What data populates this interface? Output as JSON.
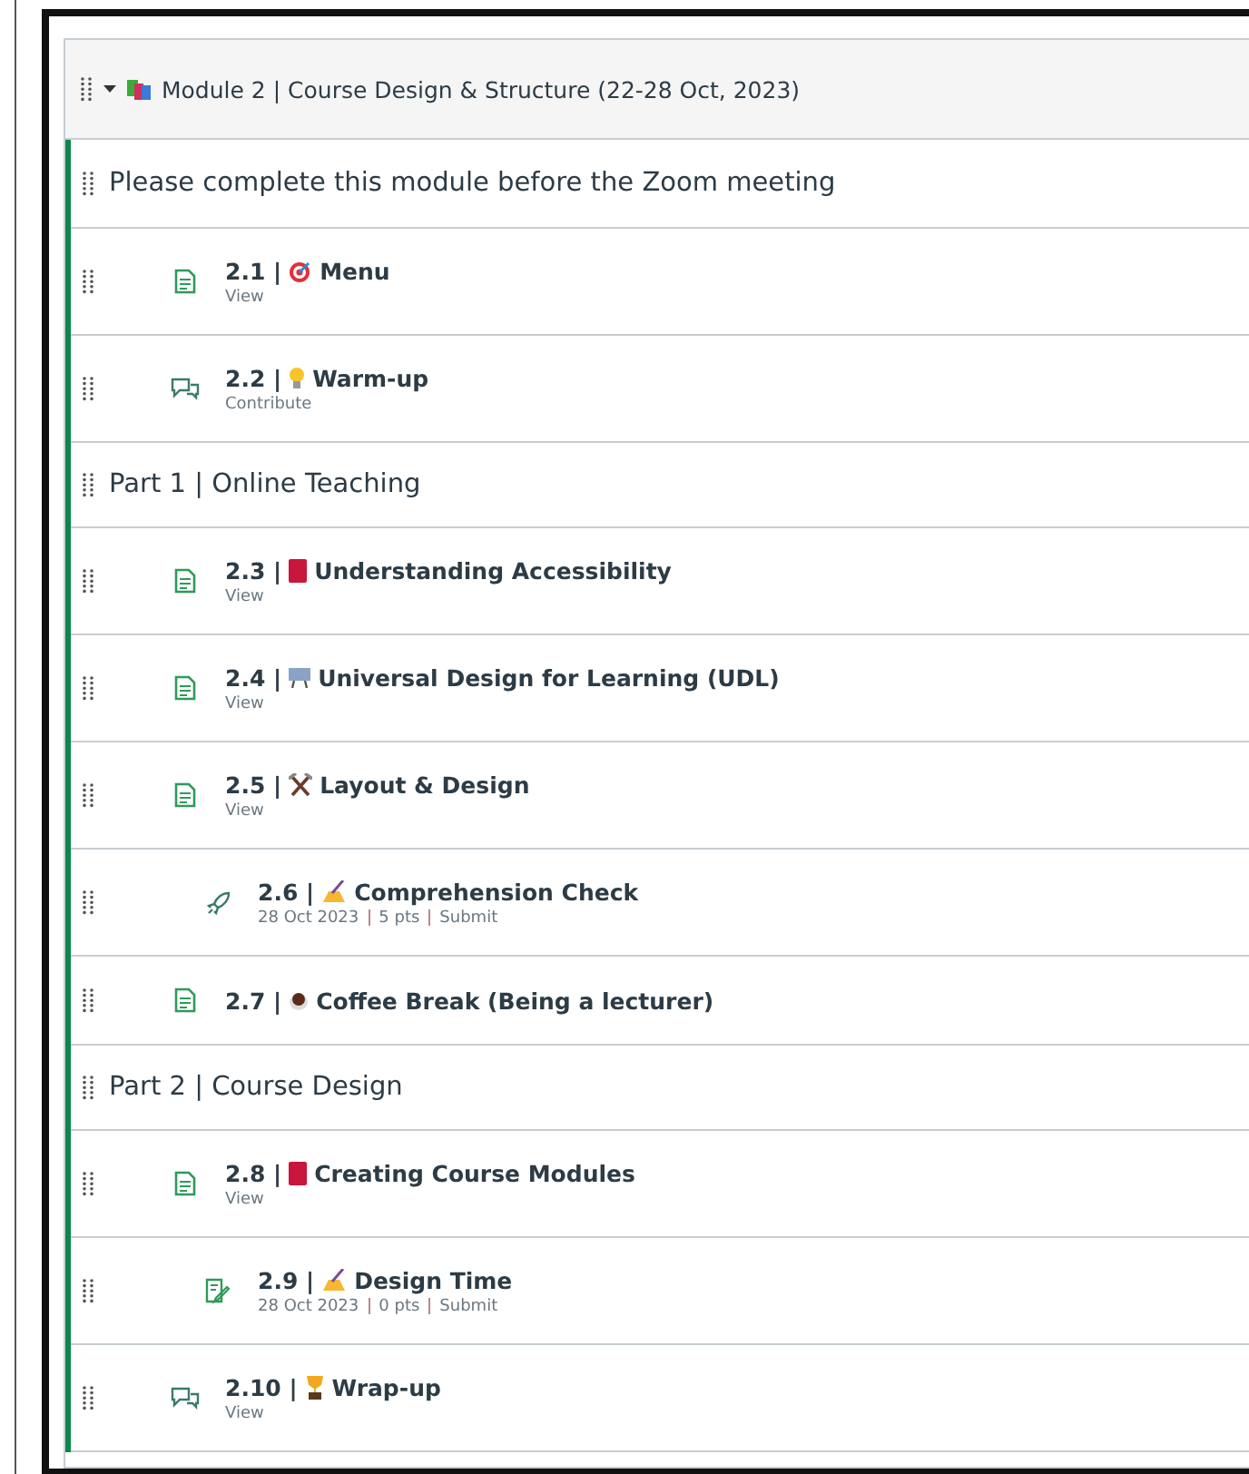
{
  "module": {
    "title": "Module 2 | Course Design & Structure (22-28 Oct, 2023)",
    "expanded": true
  },
  "rows": [
    {
      "kind": "header",
      "title": "Please complete this module before the Zoom meeting"
    },
    {
      "kind": "page",
      "number": "2.1 |",
      "title": "Menu",
      "meta": [
        "View"
      ]
    },
    {
      "kind": "discussion",
      "number": "2.2 |",
      "title": "Warm-up",
      "meta": [
        "Contribute"
      ]
    },
    {
      "kind": "header",
      "title": "Part 1 | Online Teaching"
    },
    {
      "kind": "page",
      "number": "2.3 |",
      "title": "Understanding Accessibility",
      "meta": [
        "View"
      ]
    },
    {
      "kind": "page",
      "number": "2.4 |",
      "title": "Universal Design for Learning (UDL)",
      "meta": [
        "View"
      ]
    },
    {
      "kind": "page",
      "number": "2.5 |",
      "title": "Layout & Design",
      "meta": [
        "View"
      ]
    },
    {
      "kind": "quiz",
      "number": "2.6 |",
      "title": "Comprehension Check",
      "meta": [
        "28 Oct 2023",
        "5 pts",
        "Submit"
      ]
    },
    {
      "kind": "page",
      "number": "2.7 |",
      "title": "Coffee Break (Being a lecturer)"
    },
    {
      "kind": "header",
      "title": "Part 2 | Course Design"
    },
    {
      "kind": "page",
      "number": "2.8 |",
      "title": "Creating Course Modules",
      "meta": [
        "View"
      ]
    },
    {
      "kind": "assignment",
      "number": "2.9 |",
      "title": "Design Time",
      "meta": [
        "28 Oct 2023",
        "0 pts",
        "Submit"
      ]
    },
    {
      "kind": "discussion",
      "number": "2.10 |",
      "title": "Wrap-up",
      "meta": [
        "View"
      ]
    }
  ]
}
